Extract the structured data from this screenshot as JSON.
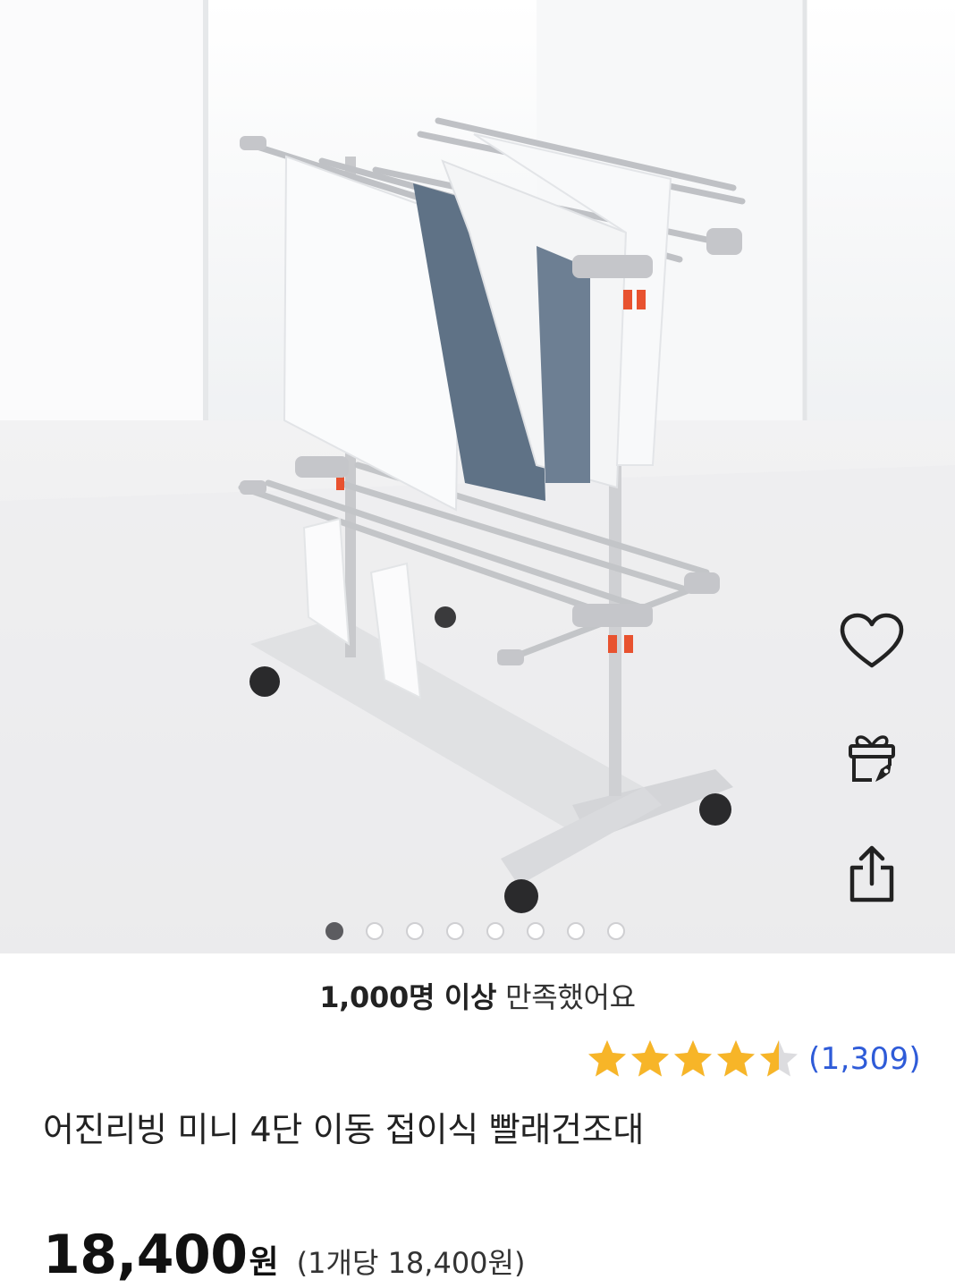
{
  "gallery": {
    "image_alt": "foldable laundry drying rack with towels",
    "image_count": 8,
    "active_index": 0
  },
  "actions": {
    "wishlist_icon": "heart-icon",
    "gift_icon": "gift-icon",
    "share_icon": "share-icon"
  },
  "satisfaction": {
    "highlight": "1,000명 이상",
    "suffix": " 만족했어요"
  },
  "rating": {
    "stars": 4.5,
    "max": 5,
    "star_color": "#f7b528",
    "review_count": "(1,309)"
  },
  "product": {
    "title": "어진리빙 미니 4단 이동 접이식 빨래건조대",
    "price": "18,400",
    "currency": "원",
    "unit_price": "(1개당 18,400원)"
  },
  "colors": {
    "link": "#2e5bd8",
    "accent_red": "#e8522f"
  }
}
